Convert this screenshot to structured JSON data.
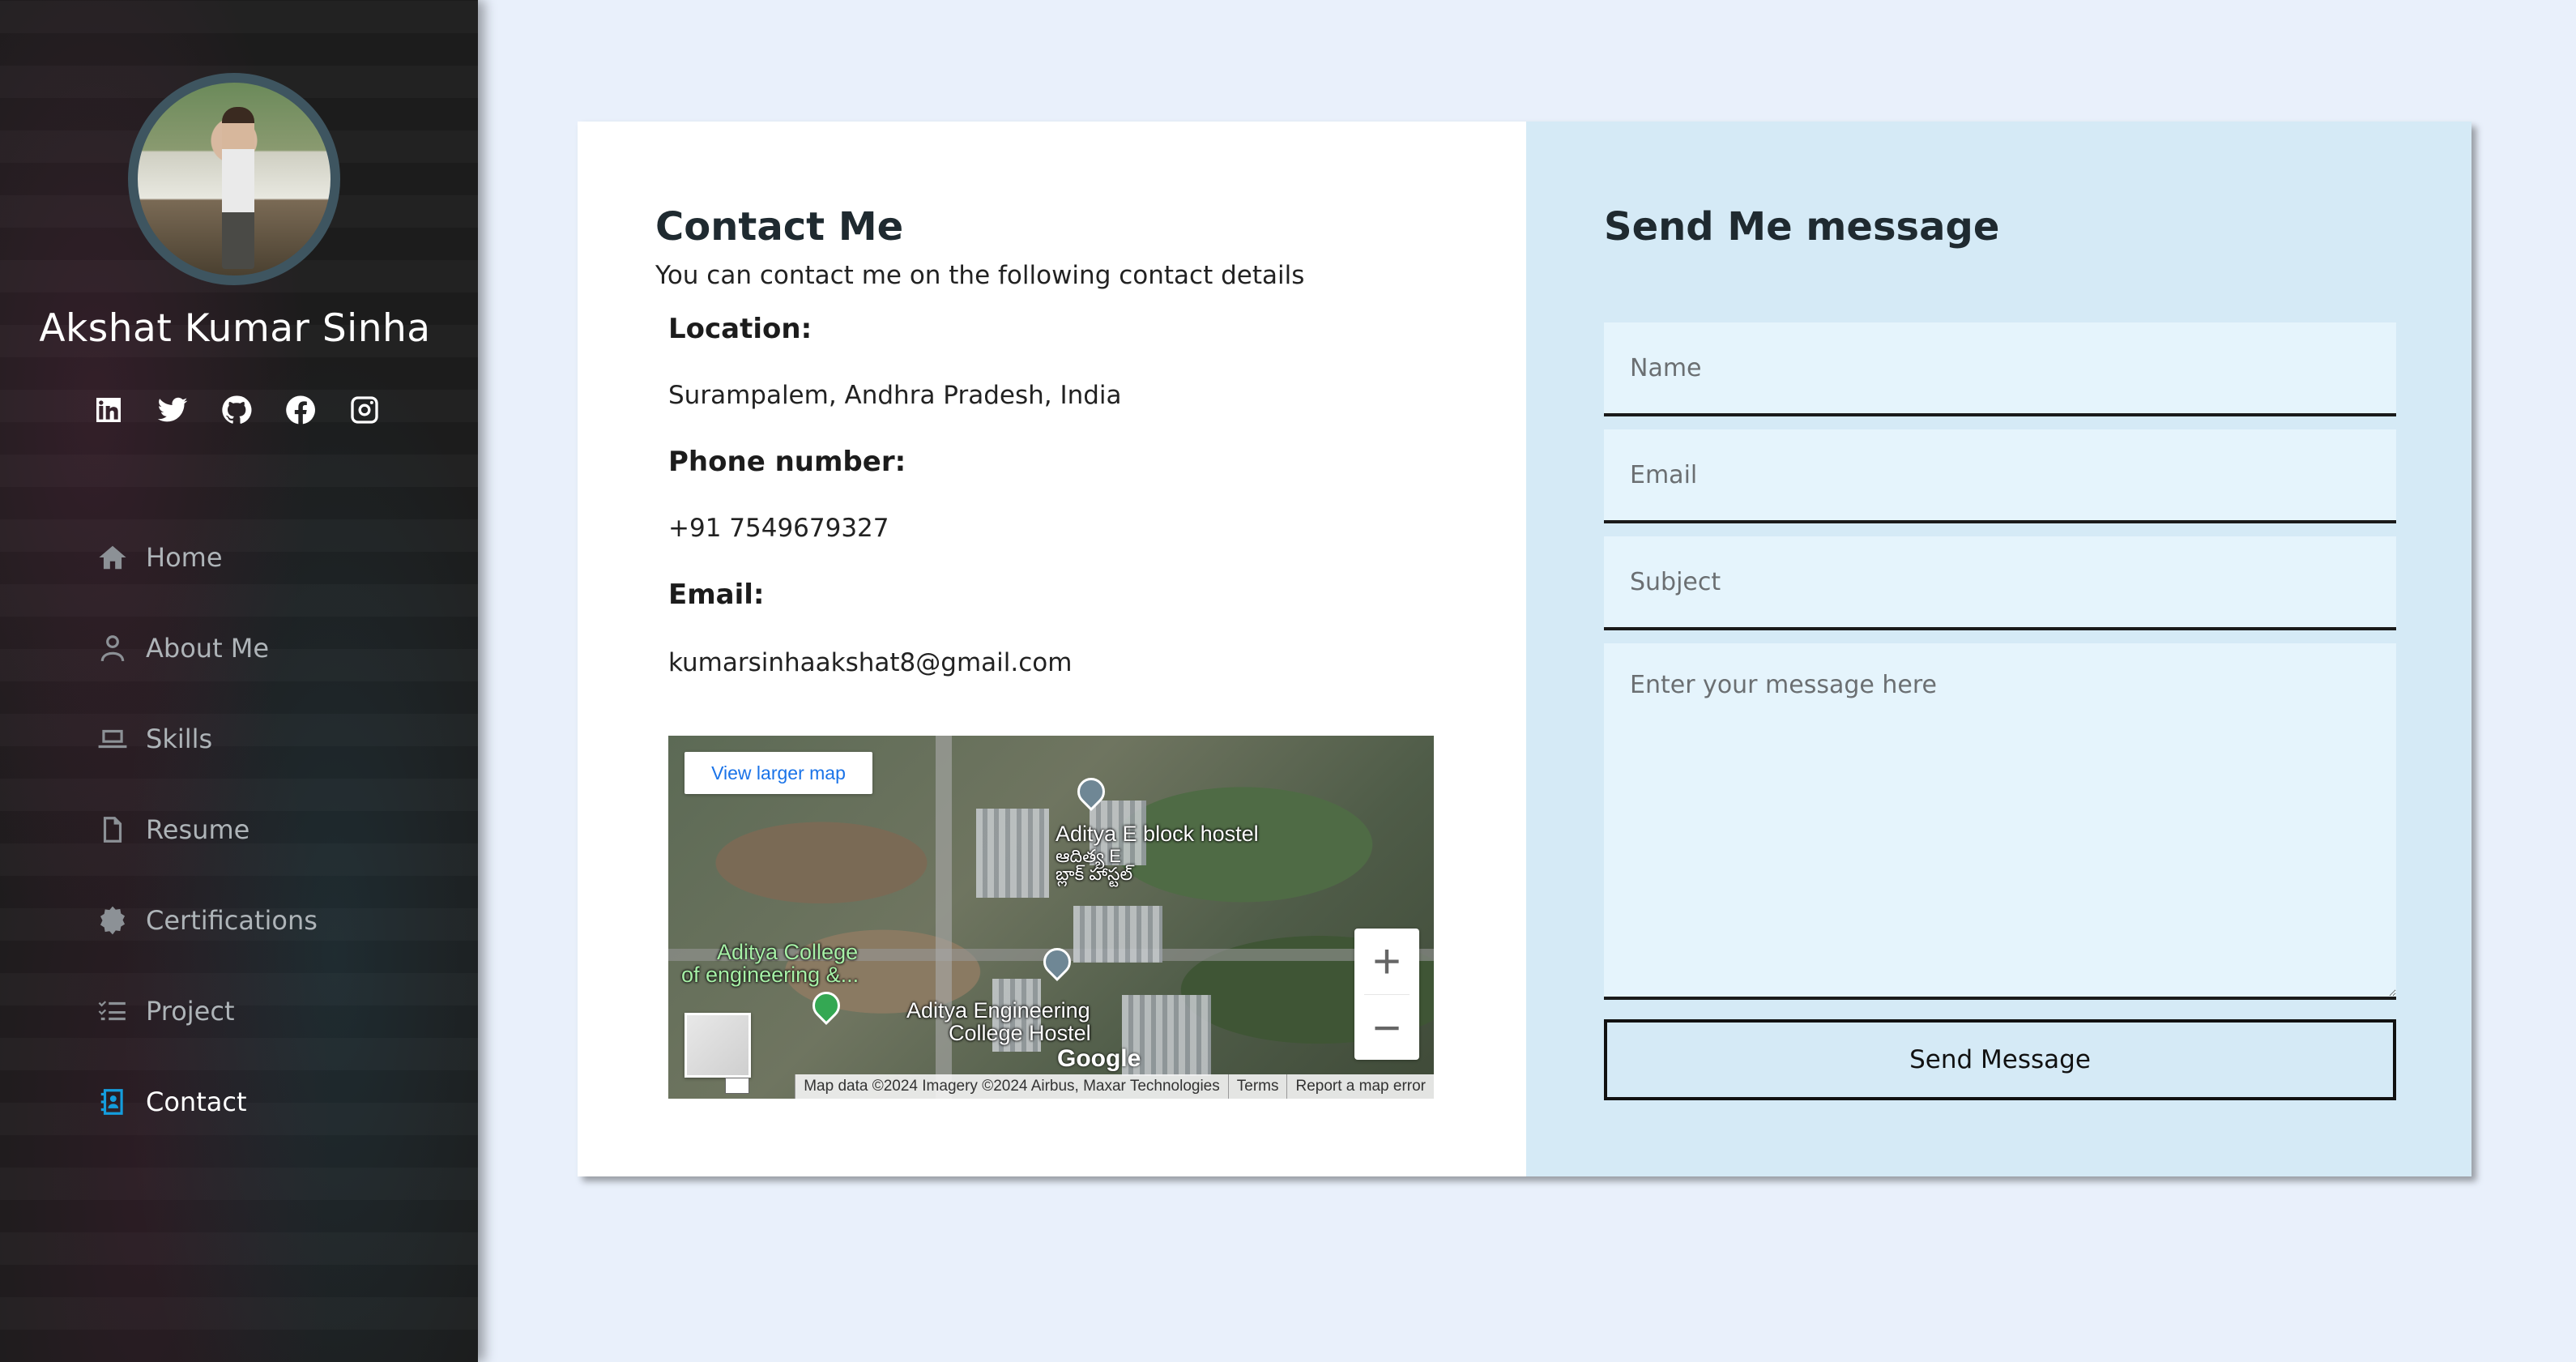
{
  "sidebar": {
    "profile_name": "Akshat Kumar Sinha",
    "socials": [
      "linkedin-icon",
      "twitter-icon",
      "github-icon",
      "facebook-icon",
      "instagram-icon"
    ],
    "nav": [
      {
        "label": "Home",
        "icon": "home-icon"
      },
      {
        "label": "About Me",
        "icon": "user-icon"
      },
      {
        "label": "Skills",
        "icon": "laptop-icon"
      },
      {
        "label": "Resume",
        "icon": "file-icon"
      },
      {
        "label": "Certifications",
        "icon": "badge-icon"
      },
      {
        "label": "Project",
        "icon": "list-icon"
      },
      {
        "label": "Contact",
        "icon": "contact-card-icon",
        "active": true
      }
    ],
    "active_color": "#149ddd"
  },
  "contact": {
    "title": "Contact Me",
    "intro": "You can contact me on the following contact details",
    "location_label": "Location:",
    "location_value": "Surampalem, Andhra Pradesh, India",
    "phone_label": "Phone number:",
    "phone_value": "+91 7549679327",
    "email_label": "Email:",
    "email_value": "kumarsinhaakshat8@gmail.com"
  },
  "map": {
    "view_larger": "View larger map",
    "zoom_in": "+",
    "zoom_out": "−",
    "label_hostel": "Aditya E block hostel",
    "label_hostel_local": "ఆదిత్య E బ్లాక్ హాస్టల్",
    "label_college_line1": "Aditya College",
    "label_college_line2": "of engineering &...",
    "label_eng_line1": "Aditya Engineering",
    "label_eng_line2": "College Hostel",
    "logo": "Google",
    "footer_data": "Map data ©2024 Imagery ©2024 Airbus, Maxar Technologies",
    "footer_terms": "Terms",
    "footer_report": "Report a map error"
  },
  "form": {
    "title": "Send Me message",
    "name_placeholder": "Name",
    "email_placeholder": "Email",
    "subject_placeholder": "Subject",
    "message_placeholder": "Enter your message here",
    "submit_label": "Send Message"
  }
}
